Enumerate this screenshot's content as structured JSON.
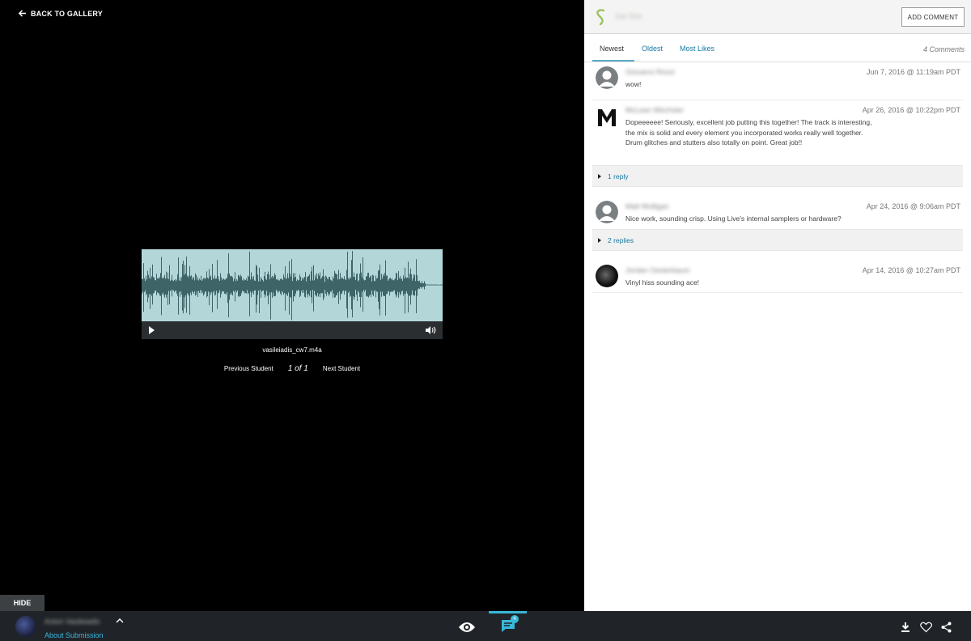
{
  "nav": {
    "back_label": "BACK TO GALLERY"
  },
  "player": {
    "filename": "vasileiadis_cw7.m4a"
  },
  "pager": {
    "prev": "Previous Student",
    "position": "1 of 1",
    "next": "Next Student"
  },
  "panel": {
    "user_name": "Joe Doe",
    "add_comment": "ADD COMMENT",
    "tabs": [
      {
        "label": "Newest"
      },
      {
        "label": "Oldest"
      },
      {
        "label": "Most Likes"
      }
    ],
    "comment_count": "4 Comments"
  },
  "comments": [
    {
      "author": "Giovanni Rossi",
      "date": "Jun 7, 2016 @ 11:19am PDT",
      "text": "wow!"
    },
    {
      "author": "McLean Wechsler",
      "date": "Apr 26, 2016 @ 10:22pm PDT",
      "text": "Dopeeeeee! Seriously, excellent job putting this together! The track is interesting, the mix is solid and every element you incorporated works really well together. Drum glitches and stutters also totally on point. Great job!!",
      "replies": "1 reply"
    },
    {
      "author": "Matt Mulligan",
      "date": "Apr 24, 2016 @ 9:06am PDT",
      "text": "Nice work, sounding crisp. Using Live's internal samplers or hardware?",
      "replies": "2 replies"
    },
    {
      "author": "Jordan Oesterbaum",
      "date": "Apr 14, 2016 @ 10:27am PDT",
      "text": "Vinyl hiss sounding ace!"
    }
  ],
  "footer": {
    "hide_label": "HIDE",
    "student_name": "Anton Vasileiadis",
    "about_label": "About Submission",
    "comment_badge": "4"
  },
  "colors": {
    "accent": "#39b7d9",
    "link": "#1779a4",
    "waveform_bg": "#b3d7d9",
    "waveform_fg": "#3f6468"
  }
}
